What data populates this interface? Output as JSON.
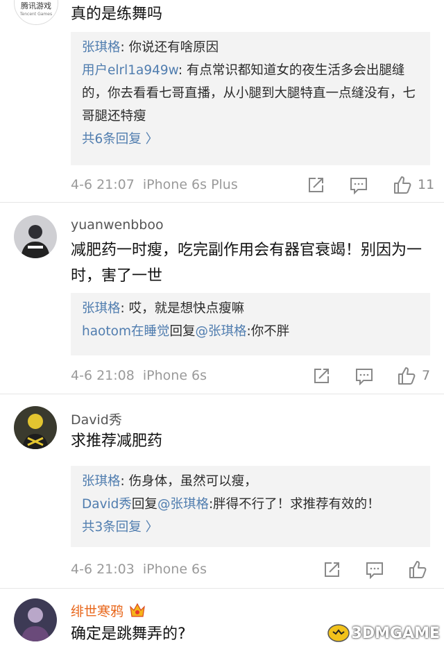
{
  "comments": [
    {
      "username": "",
      "avatar_logo_text": "腾讯游戏",
      "avatar_logo_sub": "Tencent Games",
      "content": "真的是练舞吗",
      "replies": [
        {
          "name": "张琪格",
          "text": ": 你说还有啥原因"
        },
        {
          "name": "用户elrl1a949w",
          "text": ": 有点常识都知道女的夜生活多会出腿缝的，你去看看七哥直播，从小腿到大腿特直一点缝没有，七哥腿还特瘦"
        }
      ],
      "more": "共6条回复 〉",
      "time": "4-6 21:07",
      "device": "iPhone 6s Plus",
      "likes": "11"
    },
    {
      "username": "yuanwenbboo",
      "content": "减肥药一时瘦，吃完副作用会有器官衰竭！别因为一时，害了一世",
      "replies": [
        {
          "name": "张琪格",
          "text": ": 哎，就是想快点瘦嘛"
        },
        {
          "name": "haotom在睡觉",
          "mid": "回复",
          "target": "@张琪格",
          "text": ":你不胖"
        }
      ],
      "time": "4-6 21:08",
      "device": "iPhone 6s",
      "likes": "7"
    },
    {
      "username": "David秀",
      "content": "求推荐减肥药",
      "replies": [
        {
          "name": "张琪格",
          "text": ": 伤身体，虽然可以瘦，"
        },
        {
          "name": "David秀",
          "mid": "回复",
          "target": "@张琪格",
          "text": ":胖得不行了！求推荐有效的！"
        }
      ],
      "more": "共3条回复 〉",
      "time": "4-6 21:03",
      "device": "iPhone 6s",
      "likes": ""
    },
    {
      "username": "绯世寒鸦",
      "content": "确定是跳舞弄的?"
    }
  ],
  "watermark": "3DMGAME",
  "icons": [
    "repost-icon",
    "comment-icon",
    "like-icon",
    "crown-badge-icon"
  ],
  "colors": {
    "link": "#507daf",
    "vip_name": "#e8661a",
    "meta": "#9a9a9a",
    "reply_bg": "#f3f3f3"
  }
}
